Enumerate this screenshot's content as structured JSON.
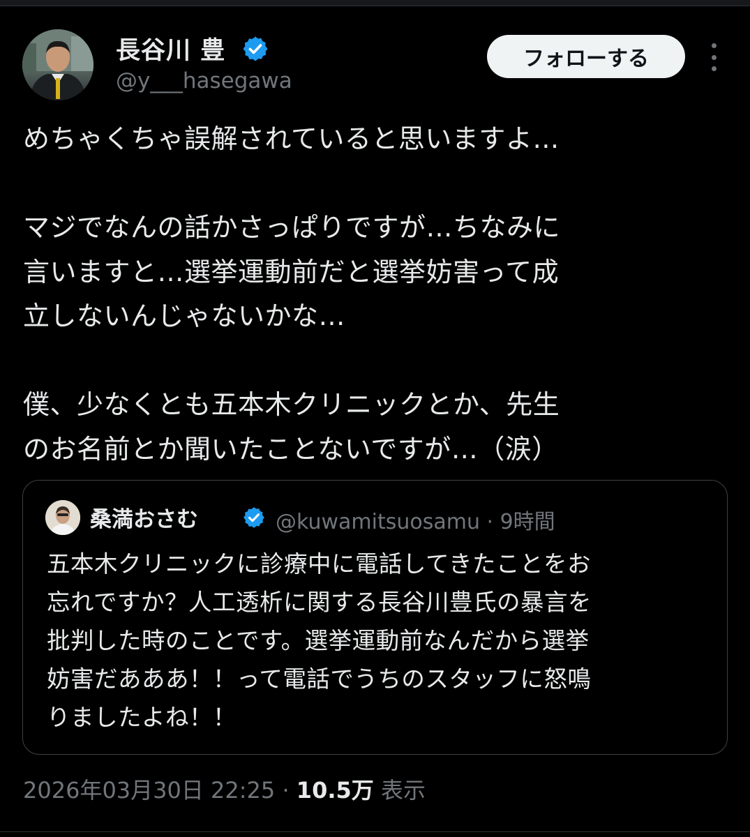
{
  "tweet": {
    "author": {
      "name": "長谷川 豊",
      "handle": "@y___hasegawa",
      "verified": true,
      "avatar": "profile-photo"
    },
    "follow_label": "フォローする",
    "more_icon": "more-dots-icon",
    "text": "めちゃくちゃ誤解されていると思いますよ…\n\nマジでなんの話かさっぱりですが…ちなみに\n言いますと…選挙運動前だと選挙妨害って成\n立しないんじゃないかな…\n\n僕、少なくとも五本木クリニックとか、先生\nのお名前とか聞いたことないですが…（涙）",
    "quote": {
      "name": "桑満おさむ",
      "meta": "@kuwamitsuosamu · 9時間",
      "verified": true,
      "text": "五本木クリニックに診療中に電話してきたことをお\n忘れですか？人工透析に関する長谷川豊氏の暴言を\n批判した時のことです。選挙運動前なんだから選挙\n妨害だあああ！！って電話でうちのスタッフに怒鳴\nりましたよね！！"
    },
    "timestamp": "2026年03月30日 22:25",
    "separator": " · ",
    "views_count": "10.5万",
    "views_label": " 表示"
  },
  "colors": {
    "background": "#000000",
    "text": "#e7e9ea",
    "secondary": "#71767b",
    "verified_blue": "#1d9bf0",
    "border": "#2f3336"
  }
}
